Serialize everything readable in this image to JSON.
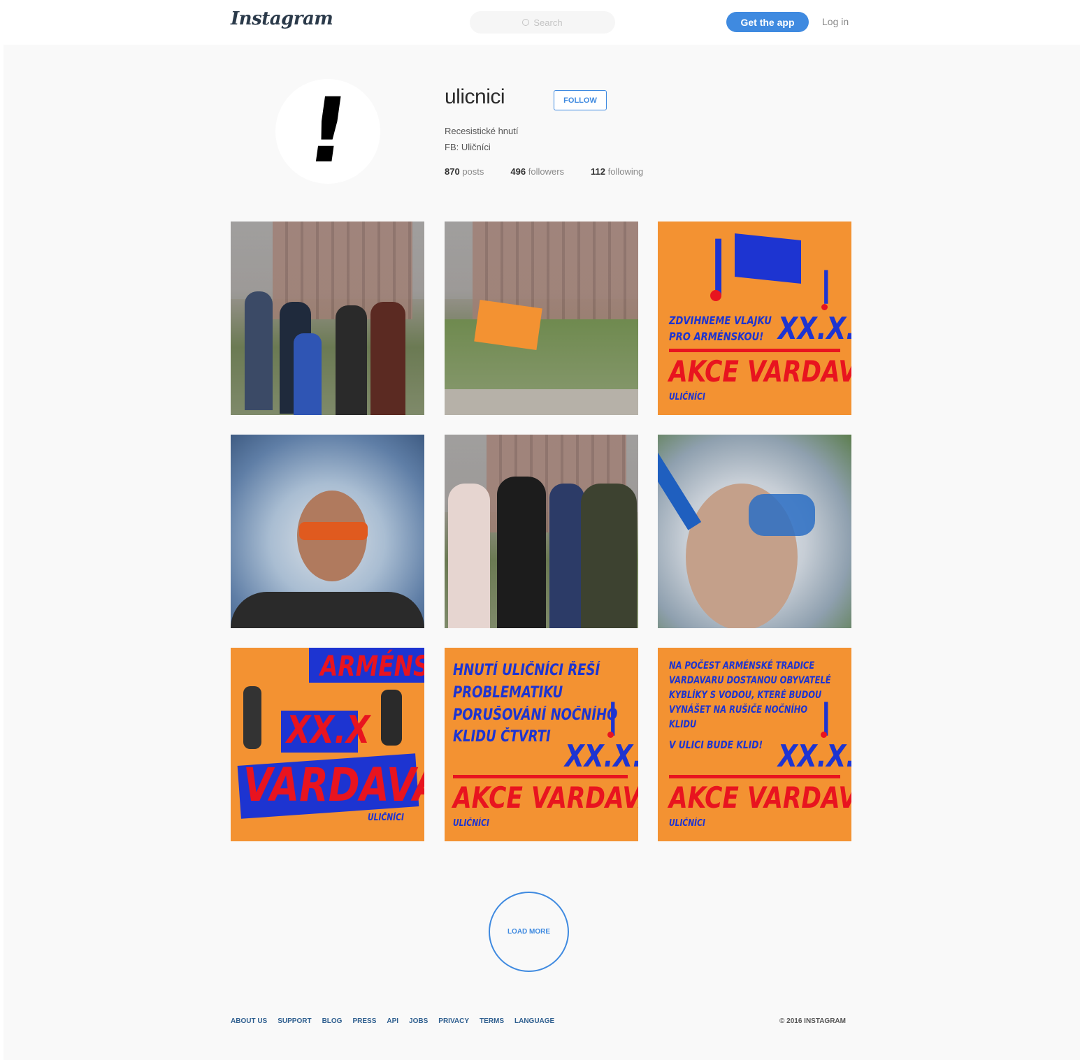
{
  "header": {
    "logo": "Instagram",
    "search_placeholder": "Search",
    "get_app_label": "Get the app",
    "login_label": "Log in"
  },
  "profile": {
    "avatar_glyph": "!",
    "username": "ulicnici",
    "follow_label": "FOLLOW",
    "bio_line1": "Recesistické hnutí",
    "bio_line2": "FB: Uličníci",
    "stats": [
      {
        "count": "870",
        "label": "posts"
      },
      {
        "count": "496",
        "label": "followers"
      },
      {
        "count": "112",
        "label": "following"
      }
    ]
  },
  "posts": {
    "p3": {
      "line1": "ZDVIHNEME VLAJKU",
      "line2": "PRO ARMÉNSKOU!",
      "date": "XX.X.",
      "headline": "AKCE VARDAVAR!",
      "brand": "ULIČNÍCI"
    },
    "p7": {
      "top": "ARMÉNSKÁ",
      "date": "XX.X",
      "headline": "VARDAVAR!",
      "brand": "ULIČNÍCI"
    },
    "p8": {
      "line1": "HNUTÍ ULIČNÍCI ŘEŠÍ",
      "line2": "PROBLEMATIKU",
      "line3": "PORUŠOVÁNÍ NOČNÍHO",
      "line4": "KLIDU ČTVRTI",
      "date": "XX.X.",
      "headline": "AKCE VARDAVAR!",
      "brand": "ULIČNÍCI"
    },
    "p9": {
      "line1": "NA POČEST ARMÉNSKÉ TRADICE",
      "line2": "VARDAVARU DOSTANOU OBYVATELÉ",
      "line3": "KYBLÍKY S VODOU, KTERÉ BUDOU",
      "line4": "VYNÁŠET NA RUŠIČE NOČNÍHO",
      "line5": "KLIDU",
      "line6": "V ULICI BUDE KLID!",
      "date": "XX.X.",
      "headline": "AKCE VARDAVAR!",
      "brand": "ULIČNÍCI"
    }
  },
  "load_more_label": "LOAD MORE",
  "footer": {
    "links": [
      "ABOUT US",
      "SUPPORT",
      "BLOG",
      "PRESS",
      "API",
      "JOBS",
      "PRIVACY",
      "TERMS",
      "LANGUAGE"
    ],
    "copyright": "© 2016 INSTAGRAM"
  },
  "colors": {
    "accent": "#3f8ae0",
    "poster_orange": "#f39232",
    "poster_blue": "#1d34d1",
    "poster_red": "#e8141f"
  }
}
